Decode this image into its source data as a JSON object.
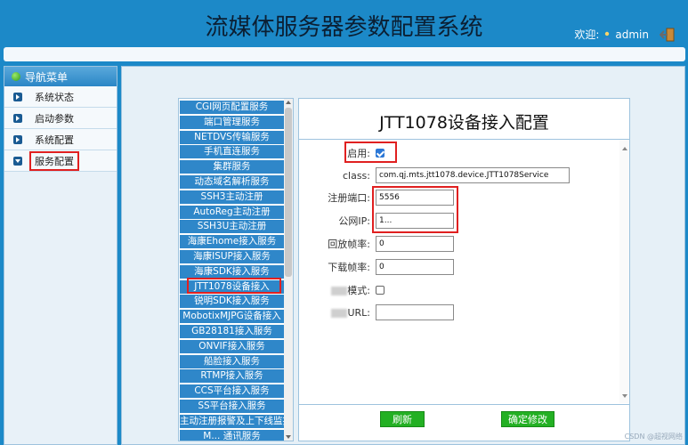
{
  "header": {
    "title": "流媒体服务器参数配置系统",
    "welcome_label": "欢迎:",
    "username": "admin"
  },
  "sidebar": {
    "title": "导航菜单",
    "items": [
      {
        "label": "系统状态"
      },
      {
        "label": "启动参数"
      },
      {
        "label": "系统配置"
      },
      {
        "label": "服务配置"
      }
    ]
  },
  "services": [
    "CGI网页配置服务",
    "端口管理服务",
    "NETDVS传输服务",
    "手机直连服务",
    "集群服务",
    "动态域名解析服务",
    "SSH3主动注册",
    "AutoReg主动注册",
    "SSH3U主动注册",
    "海康Ehome接入服务",
    "海康ISUP接入服务",
    "海康SDK接入服务",
    "JTT1078设备接入",
    "锐明SDK接入服务",
    "MobotixMJPG设备接入",
    "GB28181接入服务",
    "ONVIF接入服务",
    "船脸接入服务",
    "RTMP接入服务",
    "CCS平台接入服务",
    "SS平台接入服务",
    "主动注册报警及上下线监控",
    "M... 通讯服务"
  ],
  "config": {
    "title": "JTT1078设备接入配置",
    "enable_label": "启用:",
    "class_label": "class:",
    "class_value": "com.qj.mts.jtt1078.device.JTT1078Service",
    "port_label": "注册端口:",
    "port_value": "5556",
    "ip_label": "公网IP:",
    "ip_value": "1...",
    "playback_label": "回放帧率:",
    "playback_value": "0",
    "download_label": "下载帧率:",
    "download_value": "0",
    "mode_label": "模式:",
    "url_label": "URL:",
    "url_value": "",
    "refresh_button": "刷新",
    "confirm_button": "确定修改"
  },
  "watermark": "CSDN @超视网络",
  "colors": {
    "header_bg": "#1c89c8",
    "service_item_bg": "#2f87c9",
    "button_green": "#23b023",
    "highlight_red": "#e02020"
  }
}
